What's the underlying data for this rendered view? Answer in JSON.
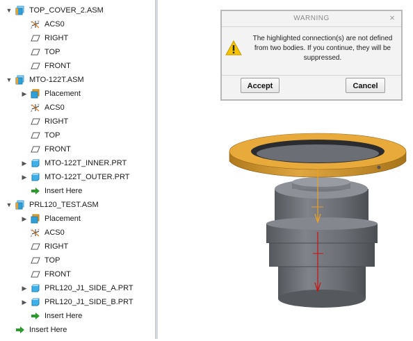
{
  "tree": {
    "items": [
      {
        "label": "TOP_COVER_2.ASM",
        "icon": "assembly-icon",
        "expander": "collapse",
        "indent": 0
      },
      {
        "label": "ACS0",
        "icon": "csys-icon",
        "expander": "none",
        "indent": 1
      },
      {
        "label": "RIGHT",
        "icon": "datum-plane-icon",
        "expander": "none",
        "indent": 1
      },
      {
        "label": "TOP",
        "icon": "datum-plane-icon",
        "expander": "none",
        "indent": 1
      },
      {
        "label": "FRONT",
        "icon": "datum-plane-icon",
        "expander": "none",
        "indent": 1
      },
      {
        "label": "MTO-122T.ASM",
        "icon": "assembly-icon",
        "expander": "collapse",
        "indent": 0
      },
      {
        "label": "Placement",
        "icon": "placement-icon",
        "expander": "expand",
        "indent": 1
      },
      {
        "label": "ACS0",
        "icon": "csys-icon",
        "expander": "none",
        "indent": 1
      },
      {
        "label": "RIGHT",
        "icon": "datum-plane-icon",
        "expander": "none",
        "indent": 1
      },
      {
        "label": "TOP",
        "icon": "datum-plane-icon",
        "expander": "none",
        "indent": 1
      },
      {
        "label": "FRONT",
        "icon": "datum-plane-icon",
        "expander": "none",
        "indent": 1
      },
      {
        "label": "MTO-122T_INNER.PRT",
        "icon": "part-icon",
        "expander": "expand",
        "indent": 1
      },
      {
        "label": "MTO-122T_OUTER.PRT",
        "icon": "part-icon",
        "expander": "expand",
        "indent": 1
      },
      {
        "label": "Insert Here",
        "icon": "insert-arrow-icon",
        "expander": "none",
        "indent": 1
      },
      {
        "label": "PRL120_TEST.ASM",
        "icon": "assembly-icon",
        "expander": "collapse",
        "indent": 0
      },
      {
        "label": "Placement",
        "icon": "placement-icon",
        "expander": "expand",
        "indent": 1
      },
      {
        "label": "ACS0",
        "icon": "csys-icon",
        "expander": "none",
        "indent": 1
      },
      {
        "label": "RIGHT",
        "icon": "datum-plane-icon",
        "expander": "none",
        "indent": 1
      },
      {
        "label": "TOP",
        "icon": "datum-plane-icon",
        "expander": "none",
        "indent": 1
      },
      {
        "label": "FRONT",
        "icon": "datum-plane-icon",
        "expander": "none",
        "indent": 1
      },
      {
        "label": "PRL120_J1_SIDE_A.PRT",
        "icon": "part-icon",
        "expander": "expand",
        "indent": 1
      },
      {
        "label": "PRL120_J1_SIDE_B.PRT",
        "icon": "part-icon",
        "expander": "expand",
        "indent": 1
      },
      {
        "label": "Insert Here",
        "icon": "insert-arrow-icon",
        "expander": "none",
        "indent": 1
      },
      {
        "label": "Insert Here",
        "icon": "insert-arrow-icon",
        "expander": "none",
        "indent": 0
      }
    ]
  },
  "dialog": {
    "title": "WARNING",
    "close_glyph": "×",
    "message": "The highlighted connection(s) are not defined from two bodies. If you continue, they will be suppressed.",
    "accept_label": "Accept",
    "cancel_label": "Cancel"
  },
  "colors": {
    "accent_orange": "#f0a020",
    "assembly_blue": "#2f9fd8",
    "warning_yellow": "#f5c400",
    "insert_green": "#2a9a2a",
    "part_dark": "#6d7076",
    "ring_gold": "#d9a038",
    "axis_red": "#cc1111"
  }
}
